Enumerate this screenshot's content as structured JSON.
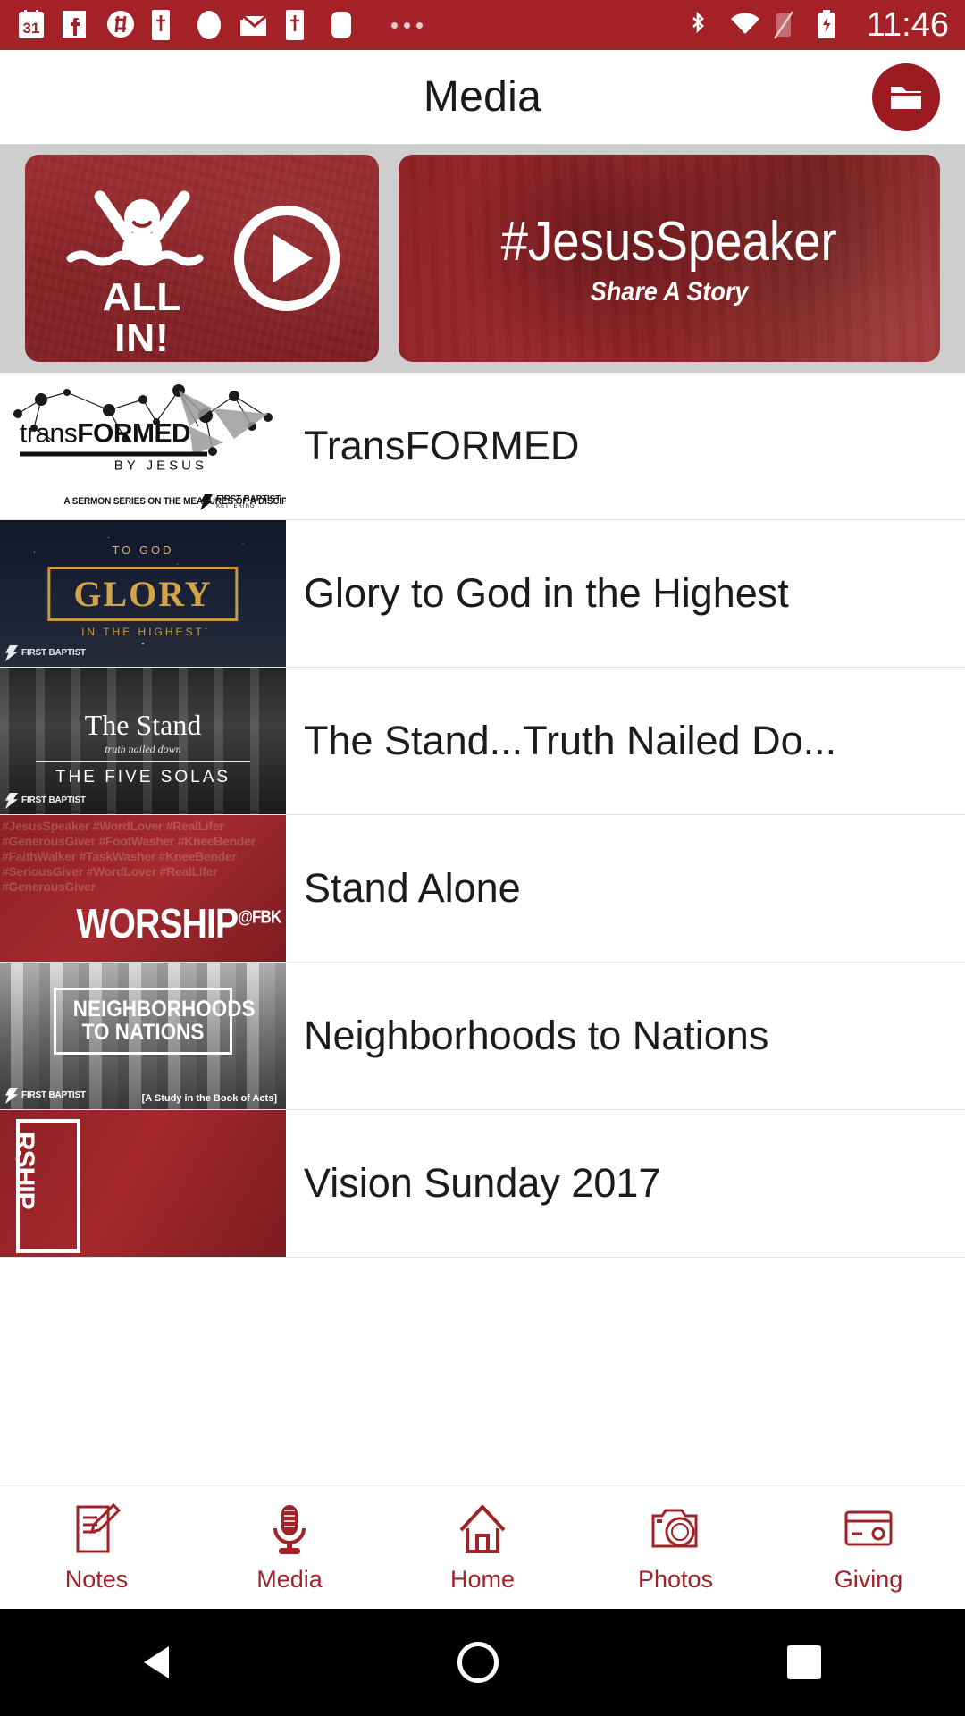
{
  "status_bar": {
    "time": "11:46",
    "left_icons": [
      "calendar-icon",
      "facebook-icon",
      "slack-icon",
      "bible-app-icon",
      "oval-notification-icon",
      "gmail-icon",
      "bible-app-icon-2",
      "rounded-square-icon"
    ],
    "overflow": "more-notifications-dots",
    "right_icons": [
      "bluetooth-icon",
      "wifi-icon",
      "sim-off-icon",
      "battery-charging-icon"
    ]
  },
  "header": {
    "title": "Media",
    "action_icon": "folder-icon"
  },
  "banners": [
    {
      "name": "all-in-banner",
      "line1": "ALL",
      "line2": "IN!",
      "icon": "person-in-water-icon",
      "play": "play-icon"
    },
    {
      "name": "jesus-speaker-banner",
      "title": "#JesusSpeaker",
      "subtitle": "Share A Story"
    }
  ],
  "media_list": [
    {
      "title": "TransFORMED",
      "thumb": {
        "kind": "transformed-logo",
        "logo_light": "trans",
        "logo_bold": "FORMED",
        "logo_sub": "BY JESUS",
        "caption": "A SERMON SERIES ON THE MEASURES OF A DISCIPLE",
        "brand": "FIRST BAPTIST",
        "brand_sub": "KETTERING"
      }
    },
    {
      "title": "Glory to God in the Highest",
      "thumb": {
        "kind": "glory-artwork",
        "top": "TO GOD",
        "main": "GLORY",
        "bottom": "IN THE HIGHEST",
        "brand": "FIRST BAPTIST"
      }
    },
    {
      "title": "The Stand...Truth Nailed Do...",
      "thumb": {
        "kind": "the-stand-artwork",
        "main": "The Stand",
        "script": "truth nailed down",
        "sub": "THE FIVE SOLAS",
        "brand": "FIRST BAPTIST"
      }
    },
    {
      "title": "Stand Alone",
      "thumb": {
        "kind": "worship-fbk-artwork",
        "main": "WORSHIP",
        "suffix": "@FBK",
        "tags": "#JesusSpeaker #WordLover #RealLifer #GenerousGiver #FootWasher #KneeBender #FaithWalker #TaskWasher #KneeBender #SeriousGiver #WordLover #RealLifer #GenerousGiver"
      }
    },
    {
      "title": "Neighborhoods to Nations",
      "thumb": {
        "kind": "neighborhoods-artwork",
        "line1": "NEIGHBORHOODS",
        "line2": "TO NATIONS",
        "caption": "[A Study in the Book of Acts]",
        "brand": "FIRST BAPTIST"
      }
    },
    {
      "title": "Vision Sunday 2017",
      "thumb": {
        "kind": "worship-vertical-artwork",
        "vertical_text": "RSHIP"
      }
    }
  ],
  "tab_bar": {
    "active": "Media",
    "accent": "#a02328",
    "tabs": [
      {
        "label": "Notes",
        "icon": "notepad-pencil-icon"
      },
      {
        "label": "Media",
        "icon": "microphone-icon"
      },
      {
        "label": "Home",
        "icon": "house-icon"
      },
      {
        "label": "Photos",
        "icon": "camera-icon"
      },
      {
        "label": "Giving",
        "icon": "credit-card-icon"
      }
    ]
  },
  "android_nav": {
    "back": "back-triangle-icon",
    "home": "home-circle-icon",
    "recents": "recents-square-icon"
  }
}
